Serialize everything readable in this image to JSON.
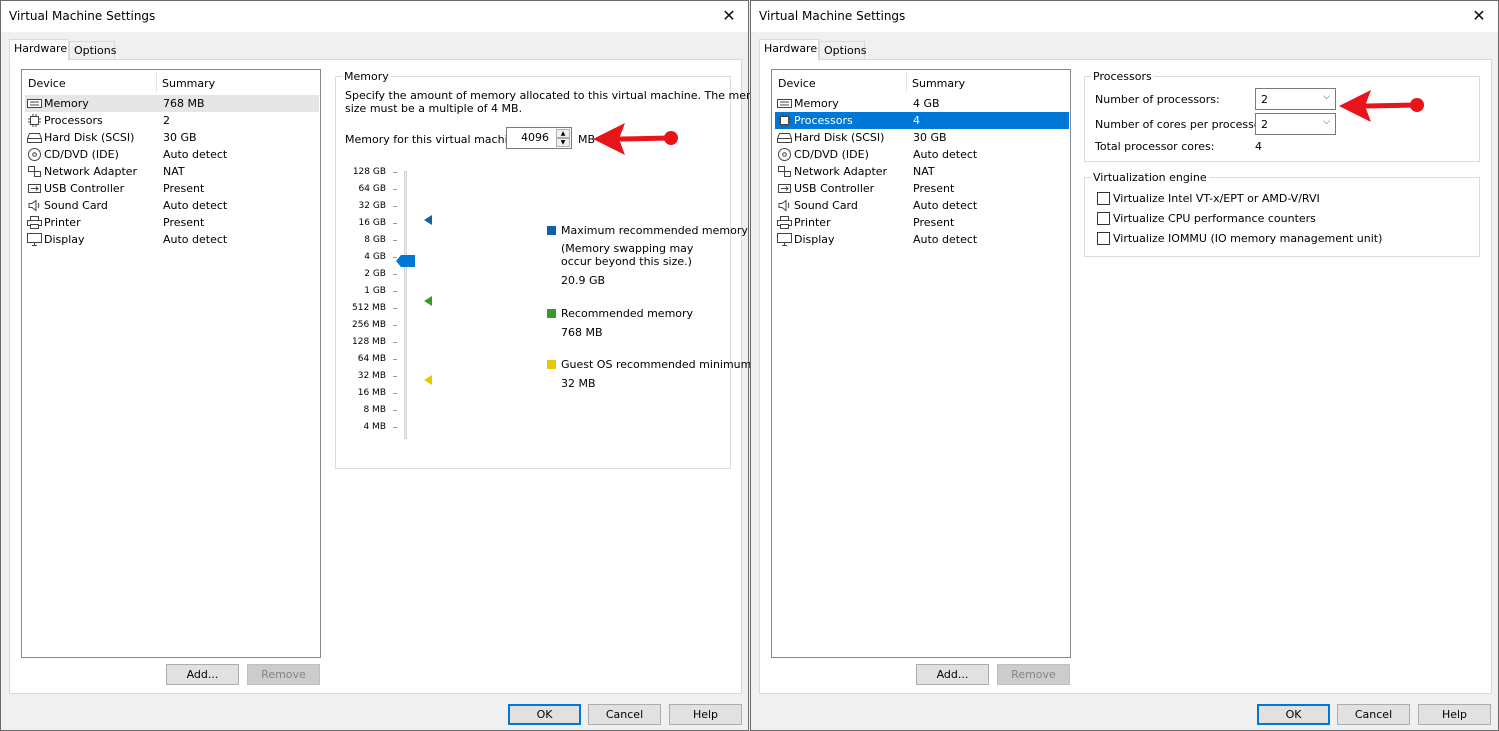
{
  "colors": {
    "accent": "#0078d7",
    "max_rec": "#1060a8",
    "rec": "#3a9b2a",
    "min_rec": "#e8c800",
    "arrow": "#e8141a"
  },
  "left": {
    "title": "Virtual Machine Settings",
    "tabs": [
      "Hardware",
      "Options"
    ],
    "list_header": {
      "device": "Device",
      "summary": "Summary"
    },
    "devices": [
      {
        "icon": "memory-icon",
        "name": "Memory",
        "summary": "768 MB"
      },
      {
        "icon": "processor-icon",
        "name": "Processors",
        "summary": "2"
      },
      {
        "icon": "hard-disk-icon",
        "name": "Hard Disk (SCSI)",
        "summary": "30 GB"
      },
      {
        "icon": "cd-dvd-icon",
        "name": "CD/DVD (IDE)",
        "summary": "Auto detect"
      },
      {
        "icon": "network-adapter-icon",
        "name": "Network Adapter",
        "summary": "NAT"
      },
      {
        "icon": "usb-icon",
        "name": "USB Controller",
        "summary": "Present"
      },
      {
        "icon": "sound-card-icon",
        "name": "Sound Card",
        "summary": "Auto detect"
      },
      {
        "icon": "printer-icon",
        "name": "Printer",
        "summary": "Present"
      },
      {
        "icon": "display-icon",
        "name": "Display",
        "summary": "Auto detect"
      }
    ],
    "add_label": "Add...",
    "remove_label": "Remove",
    "memory": {
      "group_title": "Memory",
      "description_1": "Specify the amount of memory allocated to this virtual machine. The memory",
      "description_2": "size must be a multiple of 4 MB.",
      "field_label": "Memory for this virtual machine:",
      "value": "4096",
      "unit": "MB",
      "scale": [
        "128 GB",
        "64 GB",
        "32 GB",
        "16 GB",
        "8 GB",
        "4 GB",
        "2 GB",
        "1 GB",
        "512 MB",
        "256 MB",
        "128 MB",
        "64 MB",
        "32 MB",
        "16 MB",
        "8 MB",
        "4 MB"
      ],
      "max_label": "Maximum recommended memory",
      "max_note_1": "(Memory swapping may",
      "max_note_2": "occur beyond this size.)",
      "max_value": "20.9 GB",
      "rec_label": "Recommended memory",
      "rec_value": "768 MB",
      "min_label": "Guest OS recommended minimum",
      "min_value": "32 MB"
    },
    "ok_label": "OK",
    "cancel_label": "Cancel",
    "help_label": "Help"
  },
  "right": {
    "title": "Virtual Machine Settings",
    "tabs": [
      "Hardware",
      "Options"
    ],
    "list_header": {
      "device": "Device",
      "summary": "Summary"
    },
    "devices": [
      {
        "icon": "memory-icon",
        "name": "Memory",
        "summary": "4 GB"
      },
      {
        "icon": "processor-icon",
        "name": "Processors",
        "summary": "4"
      },
      {
        "icon": "hard-disk-icon",
        "name": "Hard Disk (SCSI)",
        "summary": "30 GB"
      },
      {
        "icon": "cd-dvd-icon",
        "name": "CD/DVD (IDE)",
        "summary": "Auto detect"
      },
      {
        "icon": "network-adapter-icon",
        "name": "Network Adapter",
        "summary": "NAT"
      },
      {
        "icon": "usb-icon",
        "name": "USB Controller",
        "summary": "Present"
      },
      {
        "icon": "sound-card-icon",
        "name": "Sound Card",
        "summary": "Auto detect"
      },
      {
        "icon": "printer-icon",
        "name": "Printer",
        "summary": "Present"
      },
      {
        "icon": "display-icon",
        "name": "Display",
        "summary": "Auto detect"
      }
    ],
    "add_label": "Add...",
    "remove_label": "Remove",
    "processors": {
      "group_title": "Processors",
      "num_label": "Number of processors:",
      "num_value": "2",
      "cores_label": "Number of cores per processor:",
      "cores_value": "2",
      "total_label": "Total processor cores:",
      "total_value": "4"
    },
    "virt": {
      "group_title": "Virtualization engine",
      "opt1": "Virtualize Intel VT-x/EPT or AMD-V/RVI",
      "opt2": "Virtualize CPU performance counters",
      "opt3": "Virtualize IOMMU (IO memory management unit)"
    },
    "ok_label": "OK",
    "cancel_label": "Cancel",
    "help_label": "Help"
  }
}
